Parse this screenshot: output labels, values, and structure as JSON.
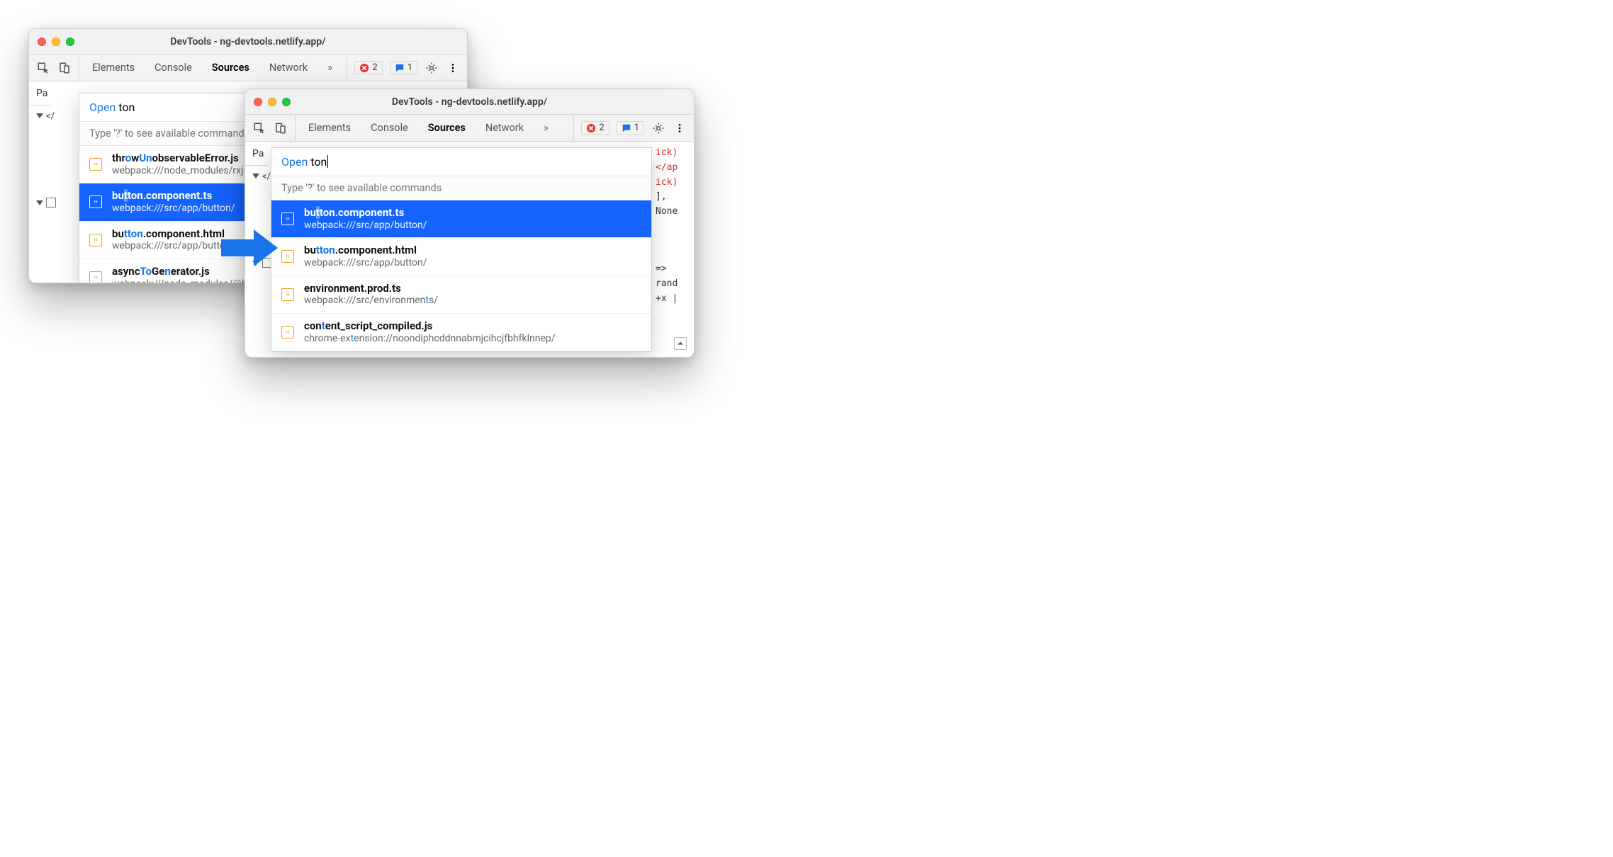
{
  "windows": [
    {
      "id": "win-left",
      "title": "DevTools - ng-devtools.netlify.app/",
      "tabs": [
        "Elements",
        "Console",
        "Sources",
        "Network"
      ],
      "active_tab": "Sources",
      "errors_badge": "2",
      "messages_badge": "1",
      "subheader": "Pa",
      "popover": {
        "open_label": "Open",
        "query": "ton",
        "show_caret": false,
        "hint": "Type '?' to see available commands",
        "selected_index": 1,
        "results": [
          {
            "filename_segments": [
              {
                "t": "t",
                "m": false
              },
              {
                "t": "h",
                "m": false
              },
              {
                "t": "r",
                "m": false
              },
              {
                "t": "o",
                "m": true
              },
              {
                "t": "w",
                "m": false
              },
              {
                "t": "U",
                "m": true
              },
              {
                "t": "n",
                "m": true
              },
              {
                "t": "observableError.js",
                "m": false
              }
            ],
            "path": "webpack:///node_modules/rxjs/dist/esm"
          },
          {
            "filename_segments": [
              {
                "t": "bu",
                "m": false
              },
              {
                "t": "t",
                "m": true,
                "bg": true
              },
              {
                "t": "ton",
                "m": true
              },
              {
                "t": ".component.ts",
                "m": false
              }
            ],
            "path": "webpack:///src/app/button/"
          },
          {
            "filename_segments": [
              {
                "t": "bu",
                "m": false
              },
              {
                "t": "t",
                "m": true
              },
              {
                "t": "ton",
                "m": true
              },
              {
                "t": ".component.html",
                "m": false
              }
            ],
            "path": "webpack:///src/app/button/"
          },
          {
            "filename_segments": [
              {
                "t": "async",
                "m": false
              },
              {
                "t": "To",
                "m": true
              },
              {
                "t": "Ge",
                "m": false
              },
              {
                "t": "n",
                "m": true
              },
              {
                "t": "erator.js",
                "m": false
              }
            ],
            "path": "webpack:///node_modules/@babel/"
          }
        ]
      }
    },
    {
      "id": "win-right",
      "title": "DevTools - ng-devtools.netlify.app/",
      "tabs": [
        "Elements",
        "Console",
        "Sources",
        "Network"
      ],
      "active_tab": "Sources",
      "errors_badge": "2",
      "messages_badge": "1",
      "subheader": "Pa",
      "popover": {
        "open_label": "Open",
        "query": "ton",
        "show_caret": true,
        "hint": "Type '?' to see available commands",
        "selected_index": 0,
        "results": [
          {
            "filename_segments": [
              {
                "t": "bu",
                "m": false
              },
              {
                "t": "t",
                "m": true,
                "bg": true
              },
              {
                "t": "ton",
                "m": true
              },
              {
                "t": ".component.ts",
                "m": false
              }
            ],
            "path": "webpack:///src/app/button/"
          },
          {
            "filename_segments": [
              {
                "t": "bu",
                "m": false
              },
              {
                "t": "t",
                "m": true
              },
              {
                "t": "ton",
                "m": true
              },
              {
                "t": ".component.html",
                "m": false
              }
            ],
            "path": "webpack:///src/app/button/"
          },
          {
            "filename_segments": [
              {
                "t": "environment.prod.ts",
                "m": false
              }
            ],
            "path_segments": [
              {
                "t": "webpack:///src/environmen",
                "m": false
              },
              {
                "t": "t",
                "m": true
              },
              {
                "t": "s/",
                "m": false
              }
            ]
          },
          {
            "filename_segments": [
              {
                "t": "con",
                "m": false
              },
              {
                "t": "t",
                "m": true
              },
              {
                "t": "ent_script_compiled.js",
                "m": false
              }
            ],
            "path_segments": [
              {
                "t": "chrome-ex",
                "m": false
              },
              {
                "t": "t",
                "m": true
              },
              {
                "t": "ension://noondiphcddnnabmjcihcjfbhfklnnep/",
                "m": false
              }
            ]
          }
        ]
      },
      "code_peek": {
        "lines": [
          "ick)",
          "</ap",
          "ick)",
          "],",
          "None"
        ],
        "tail": [
          "=>",
          "rand",
          "+x |"
        ]
      }
    }
  ]
}
